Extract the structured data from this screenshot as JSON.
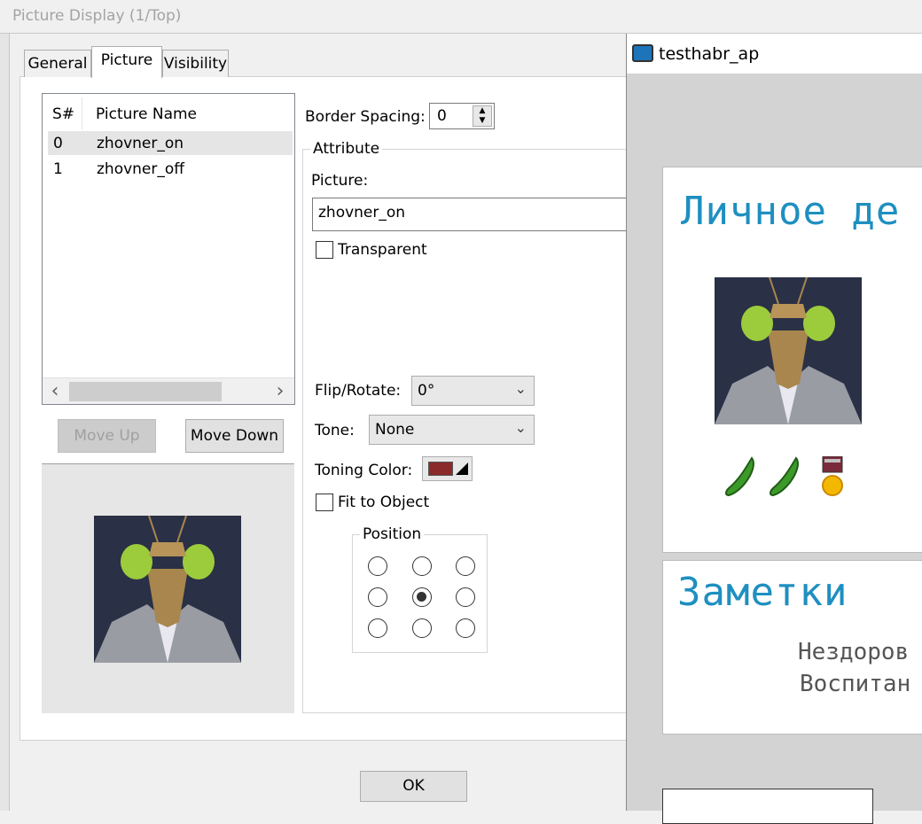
{
  "window": {
    "title": "Picture Display (1/Top)"
  },
  "tabs": [
    {
      "label": "General"
    },
    {
      "label": "Picture"
    },
    {
      "label": "Visibility"
    }
  ],
  "picture_list": {
    "columns": [
      "S#",
      "Picture Name"
    ],
    "rows": [
      {
        "s": "0",
        "name": "zhovner_on"
      },
      {
        "s": "1",
        "name": "zhovner_off"
      }
    ]
  },
  "buttons": {
    "move_up": "Move Up",
    "move_down": "Move Down",
    "ok": "OK"
  },
  "border_spacing": {
    "label": "Border Spacing:",
    "value": "0"
  },
  "attribute": {
    "title": "Attribute",
    "picture_label": "Picture:",
    "picture_value": "zhovner_on",
    "transparent_label": "Transparent",
    "flip_label": "Flip/Rotate:",
    "flip_value": "0°",
    "tone_label": "Tone:",
    "tone_value": "None",
    "toning_color_label": "Toning Color:",
    "toning_color": "#8b2a2a",
    "fit_label": "Fit to Object",
    "position_title": "Position",
    "position_selected": "center"
  },
  "preview_window": {
    "title": "testhabr_ap",
    "heading1": "Личное де",
    "heading2": "Заметки",
    "line1": "Нездоров",
    "line2": "Воспитан"
  },
  "colors": {
    "title_accent": "#1e8fc0"
  }
}
